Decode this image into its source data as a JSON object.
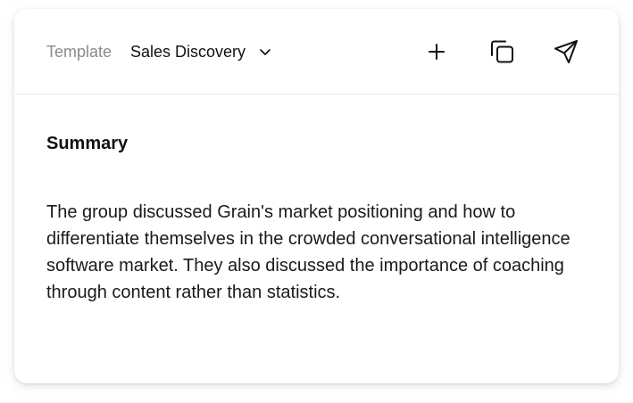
{
  "header": {
    "template_label": "Template",
    "template_value": "Sales Discovery",
    "icons": {
      "add": "plus-icon",
      "copy": "copy-icon",
      "send": "send-icon",
      "dropdown": "chevron-down-icon"
    }
  },
  "summary": {
    "heading": "Summary",
    "text": "The group discussed Grain's market positioning and how to differentiate themselves in the crowded conversational intelligence software market. They also discussed the importance of coaching through content rather than statistics."
  },
  "colors": {
    "label_gray": "#8a8a8a",
    "text_dark": "#111111",
    "divider": "#ececec",
    "card_bg": "#ffffff"
  }
}
